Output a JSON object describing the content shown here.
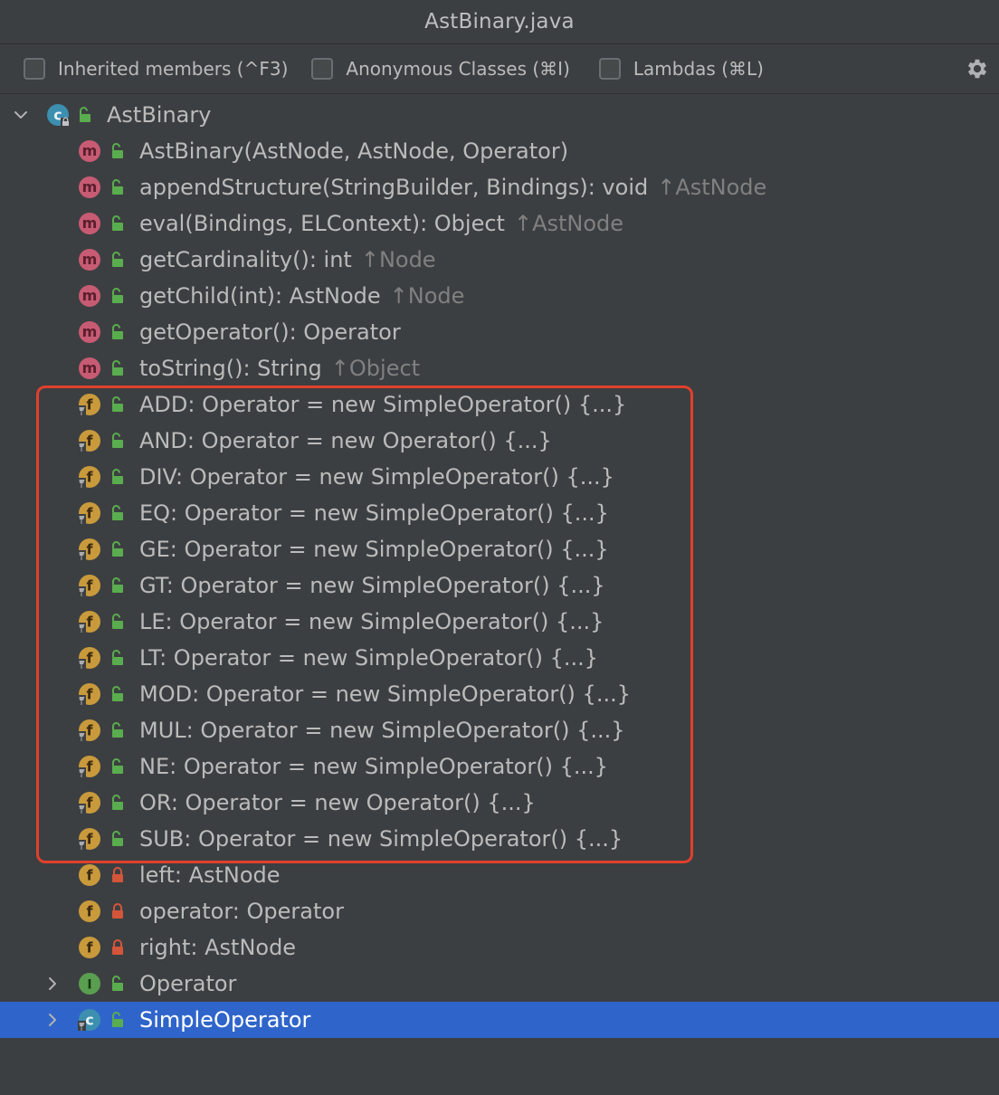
{
  "window": {
    "title": "AstBinary.java"
  },
  "toolbar": {
    "checkboxes": [
      {
        "label": "Inherited members (^F3)",
        "checked": false
      },
      {
        "label": "Anonymous Classes (⌘I)",
        "checked": false
      },
      {
        "label": "Lambdas (⌘L)",
        "checked": false
      }
    ],
    "settings_icon": "gear-icon"
  },
  "tree": {
    "root": {
      "label": "AstBinary",
      "icon": "class-icon",
      "expanded": true
    },
    "methods": [
      {
        "label": "AstBinary(AstNode, AstNode, Operator)",
        "inherit": ""
      },
      {
        "label": "appendStructure(StringBuilder, Bindings): void",
        "inherit": "↑AstNode"
      },
      {
        "label": "eval(Bindings, ELContext): Object",
        "inherit": "↑AstNode"
      },
      {
        "label": "getCardinality(): int",
        "inherit": "↑Node"
      },
      {
        "label": "getChild(int): AstNode",
        "inherit": "↑Node"
      },
      {
        "label": "getOperator(): Operator",
        "inherit": ""
      },
      {
        "label": "toString(): String",
        "inherit": "↑Object"
      }
    ],
    "static_fields": [
      "ADD: Operator = new SimpleOperator() {...}",
      "AND: Operator = new Operator() {...}",
      "DIV: Operator = new SimpleOperator() {...}",
      "EQ: Operator = new SimpleOperator() {...}",
      "GE: Operator = new SimpleOperator() {...}",
      "GT: Operator = new SimpleOperator() {...}",
      "LE: Operator = new SimpleOperator() {...}",
      "LT: Operator = new SimpleOperator() {...}",
      "MOD: Operator = new SimpleOperator() {...}",
      "MUL: Operator = new SimpleOperator() {...}",
      "NE: Operator = new SimpleOperator() {...}",
      "OR: Operator = new Operator() {...}",
      "SUB: Operator = new SimpleOperator() {...}"
    ],
    "private_fields": [
      "left: AstNode",
      "operator: Operator",
      "right: AstNode"
    ],
    "nested": [
      {
        "label": "Operator",
        "icon": "interface-icon",
        "selected": false
      },
      {
        "label": "SimpleOperator",
        "icon": "class-icon",
        "selected": true
      }
    ]
  },
  "colors": {
    "background": "#3c3f41",
    "selection": "#2f65ca",
    "highlight_border": "#e0402c",
    "method_icon": "#c75b73",
    "field_icon": "#c99a3c",
    "interface_icon": "#5a9e4f",
    "class_icon": "#3d8fb0",
    "public_lock": "#5aad4e",
    "private_lock": "#d3553a"
  }
}
